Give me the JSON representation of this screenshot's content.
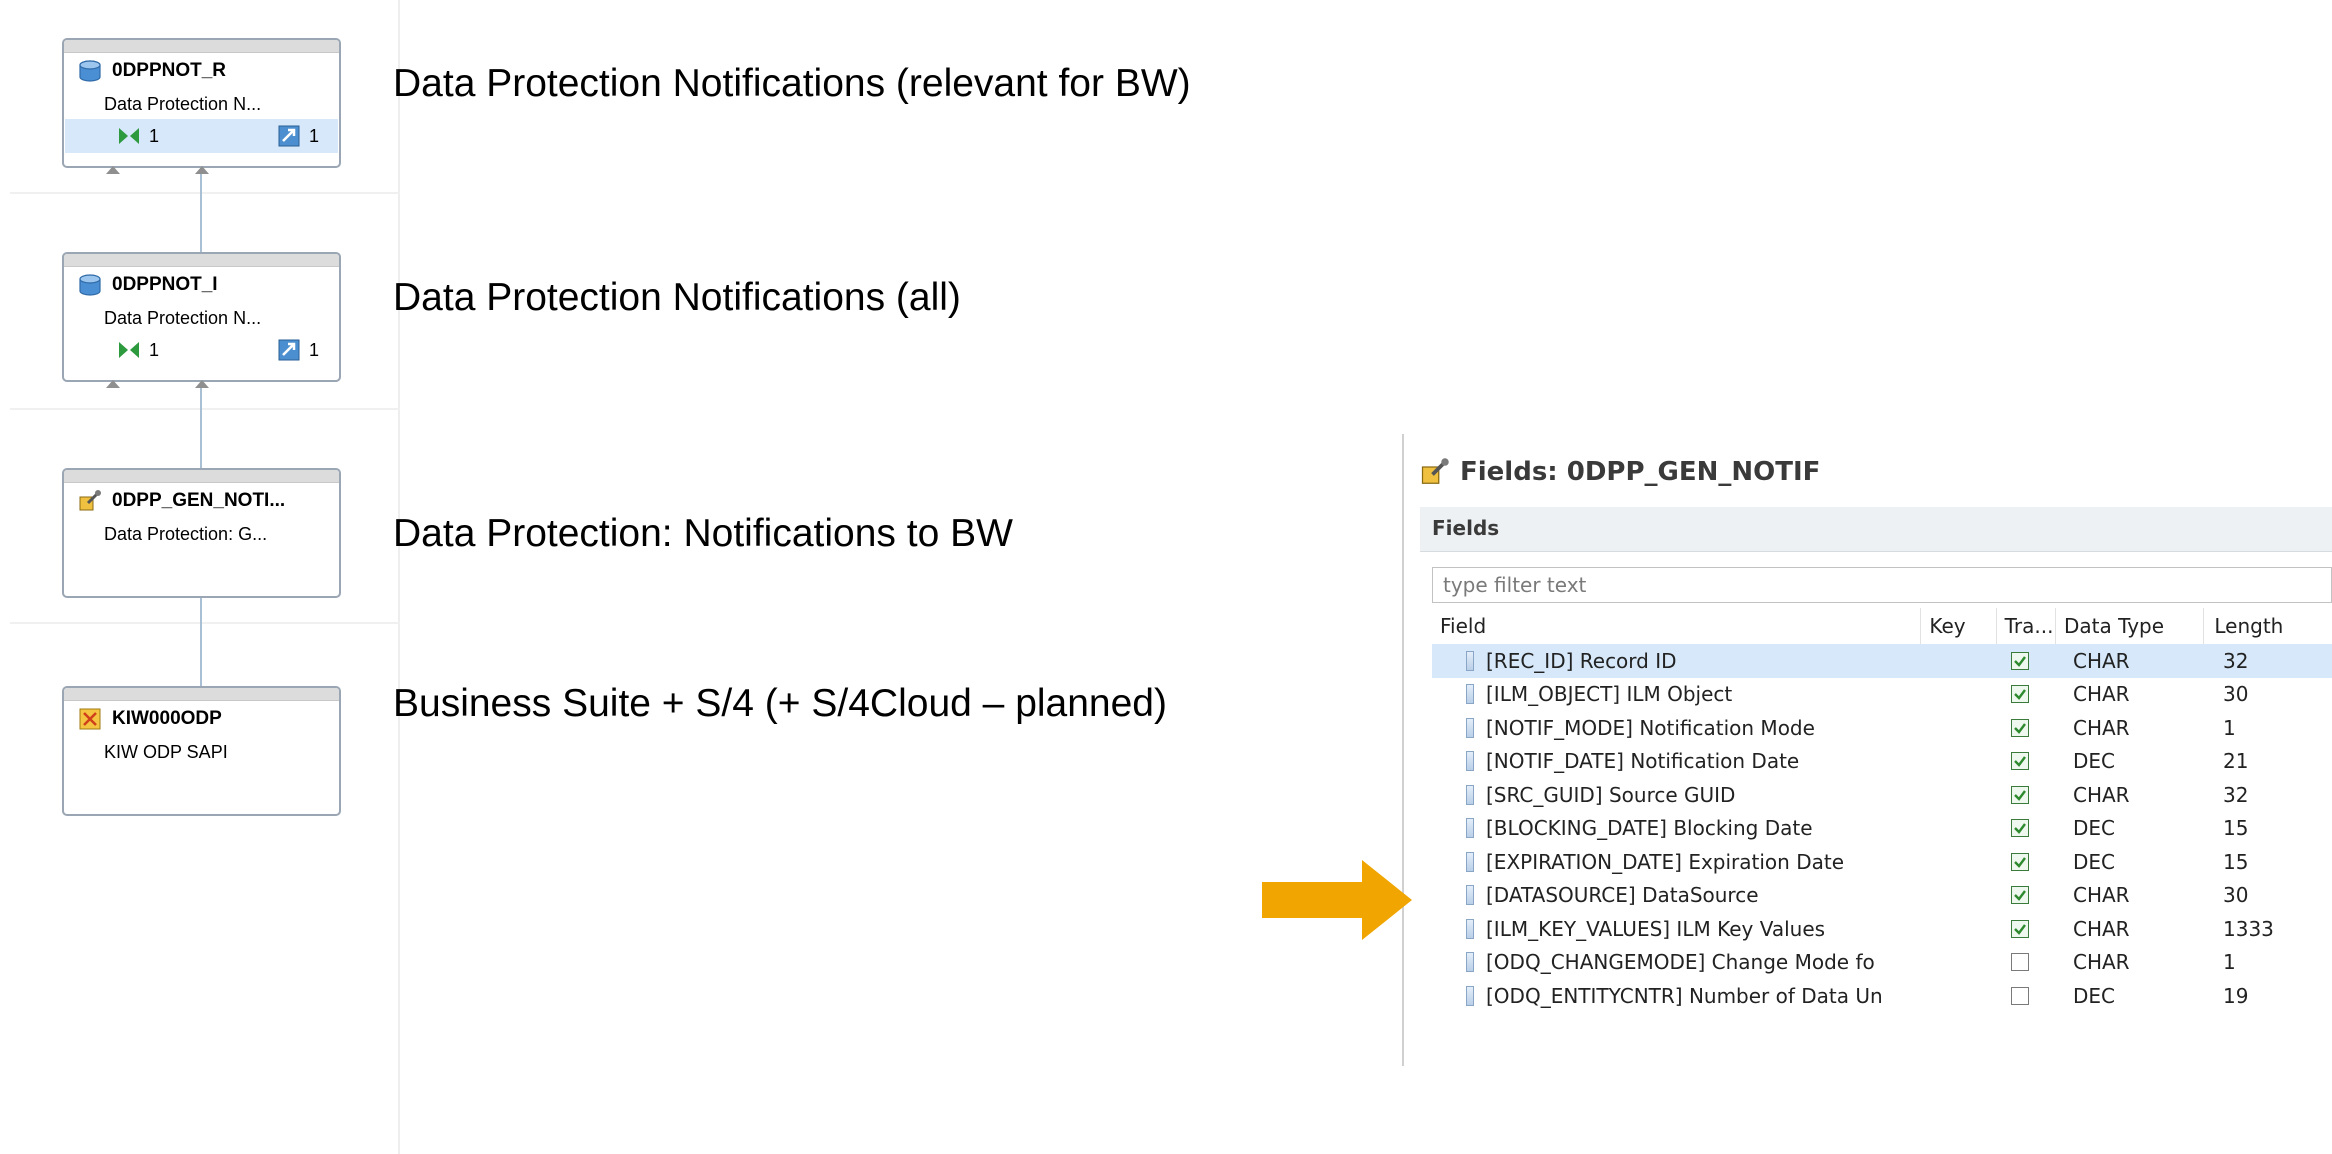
{
  "diagram": {
    "nodes": [
      {
        "title": "0DPPNOT_R",
        "subtitle": "Data Protection N...",
        "stat_in": "1",
        "stat_out": "1",
        "icon": "database-icon"
      },
      {
        "title": "0DPPNOT_I",
        "subtitle": "Data Protection N...",
        "stat_in": "1",
        "stat_out": "1",
        "icon": "database-icon"
      },
      {
        "title": "0DPP_GEN_NOTI...",
        "subtitle": "Data Protection: G...",
        "icon": "datasource-icon"
      },
      {
        "title": "KIW000ODP",
        "subtitle": "KIW ODP SAPI",
        "icon": "source-system-icon"
      }
    ]
  },
  "descriptions": [
    "Data Protection Notifications (relevant for BW)",
    "Data Protection Notifications (all)",
    "Data Protection: Notifications to BW",
    "Business Suite + S/4 (+ S/4Cloud – planned)"
  ],
  "fields_panel": {
    "title": "Fields: 0DPP_GEN_NOTIF",
    "section": "Fields",
    "filter_placeholder": "type filter text",
    "columns": {
      "field": "Field",
      "key": "Key",
      "tra": "Tra...",
      "data_type": "Data Type",
      "length": "Length"
    },
    "rows": [
      {
        "field": "[REC_ID] Record ID",
        "checked": true,
        "type": "CHAR",
        "length": "32",
        "selected": true
      },
      {
        "field": "[ILM_OBJECT] ILM Object",
        "checked": true,
        "type": "CHAR",
        "length": "30"
      },
      {
        "field": "[NOTIF_MODE] Notification Mode",
        "checked": true,
        "type": "CHAR",
        "length": "1"
      },
      {
        "field": "[NOTIF_DATE] Notification Date",
        "checked": true,
        "type": "DEC",
        "length": "21"
      },
      {
        "field": "[SRC_GUID] Source GUID",
        "checked": true,
        "type": "CHAR",
        "length": "32"
      },
      {
        "field": "[BLOCKING_DATE] Blocking Date",
        "checked": true,
        "type": "DEC",
        "length": "15"
      },
      {
        "field": "[EXPIRATION_DATE] Expiration Date",
        "checked": true,
        "type": "DEC",
        "length": "15"
      },
      {
        "field": "[DATASOURCE] DataSource",
        "checked": true,
        "type": "CHAR",
        "length": "30"
      },
      {
        "field": "[ILM_KEY_VALUES] ILM Key Values",
        "checked": true,
        "type": "CHAR",
        "length": "1333"
      },
      {
        "field": "[ODQ_CHANGEMODE] Change Mode fo",
        "checked": false,
        "type": "CHAR",
        "length": "1"
      },
      {
        "field": "[ODQ_ENTITYCNTR] Number of Data Un",
        "checked": false,
        "type": "DEC",
        "length": "19"
      }
    ]
  },
  "colors": {
    "accent_arrow": "#f0a500",
    "selection": "#d6e8f9"
  }
}
